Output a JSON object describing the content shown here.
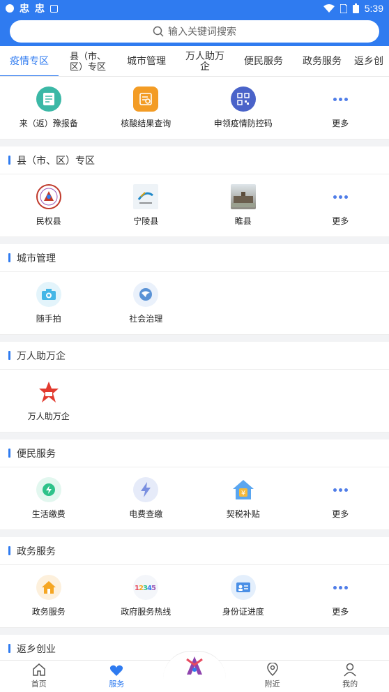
{
  "statusbar": {
    "time": "5:39"
  },
  "search": {
    "placeholder": "输入关键词搜索"
  },
  "tabs": [
    {
      "label": "疫情专区",
      "active": true
    },
    {
      "label": "县（市、区）专区"
    },
    {
      "label": "城市管理"
    },
    {
      "label": "万人助万企"
    },
    {
      "label": "便民服务"
    },
    {
      "label": "政务服务"
    },
    {
      "label": "返乡创"
    }
  ],
  "epidemic": {
    "items": [
      {
        "label": "来（返）豫报备",
        "icon": "report-icon",
        "color": "#3bb8a6"
      },
      {
        "label": "核酸结果查询",
        "icon": "test-result-icon",
        "color": "#f39c25"
      },
      {
        "label": "申领疫情防控码",
        "icon": "qr-code-icon",
        "color": "#4a63c9"
      },
      {
        "label": "更多",
        "icon": "more-icon"
      }
    ]
  },
  "sections": {
    "county": {
      "title": "县（市、区）专区",
      "items": [
        {
          "label": "民权县",
          "icon": "minquan-logo"
        },
        {
          "label": "宁陵县",
          "icon": "ningling-logo"
        },
        {
          "label": "睢县",
          "icon": "suixian-photo"
        },
        {
          "label": "更多",
          "icon": "more-icon"
        }
      ]
    },
    "city": {
      "title": "城市管理",
      "items": [
        {
          "label": "随手拍",
          "icon": "camera-icon"
        },
        {
          "label": "社会治理",
          "icon": "governance-icon"
        }
      ]
    },
    "enterprise": {
      "title": "万人助万企",
      "items": [
        {
          "label": "万人助万企",
          "icon": "enterprise-logo"
        }
      ]
    },
    "convenience": {
      "title": "便民服务",
      "items": [
        {
          "label": "生活缴费",
          "icon": "utility-icon"
        },
        {
          "label": "电费查缴",
          "icon": "electric-icon"
        },
        {
          "label": "契税补贴",
          "icon": "tax-house-icon"
        },
        {
          "label": "更多",
          "icon": "more-icon"
        }
      ]
    },
    "government": {
      "title": "政务服务",
      "items": [
        {
          "label": "政务服务",
          "icon": "gov-home-icon"
        },
        {
          "label": "政府服务热线",
          "icon": "hotline-12345-icon"
        },
        {
          "label": "身份证进度",
          "icon": "id-card-icon"
        },
        {
          "label": "更多",
          "icon": "more-icon"
        }
      ]
    },
    "hometown": {
      "title": "返乡创业",
      "icon_text": "创业",
      "items": [
        {
          "icon": "startup-icon"
        },
        {
          "icon": "coin-icon"
        }
      ]
    }
  },
  "nav": [
    {
      "label": "首页",
      "icon": "home-icon"
    },
    {
      "label": "服务",
      "icon": "heart-icon",
      "active": true
    },
    {
      "label": "",
      "icon": "center-logo"
    },
    {
      "label": "附近",
      "icon": "location-icon"
    },
    {
      "label": "我的",
      "icon": "user-icon"
    }
  ]
}
